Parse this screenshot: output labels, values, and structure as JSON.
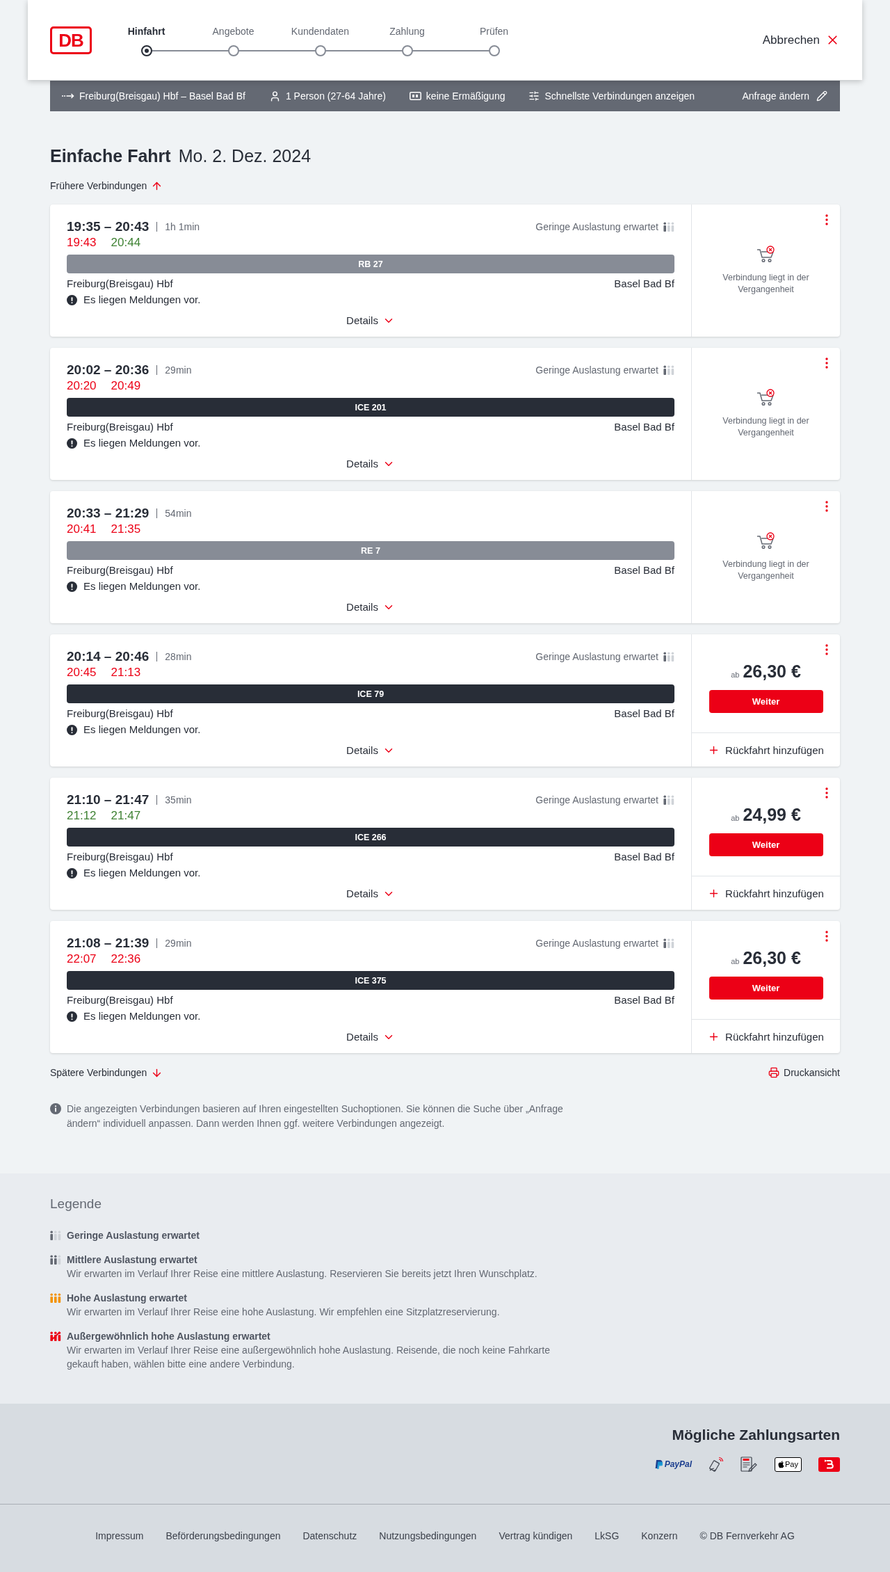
{
  "header": {
    "logo": "DB",
    "steps": [
      {
        "label": "Hinfahrt",
        "selected": true
      },
      {
        "label": "Angebote",
        "selected": false
      },
      {
        "label": "Kundendaten",
        "selected": false
      },
      {
        "label": "Zahlung",
        "selected": false
      },
      {
        "label": "Prüfen",
        "selected": false
      }
    ],
    "cancel": "Abbrechen"
  },
  "search_summary": {
    "route": "Freiburg(Breisgau) Hbf – Basel Bad Bf",
    "travellers": "1 Person (27-64 Jahre)",
    "discount": "keine Ermäßigung",
    "option": "Schnellste Verbindungen anzeigen",
    "edit": "Anfrage ändern"
  },
  "heading": {
    "trip_type": "Einfache Fahrt",
    "date": "Mo. 2. Dez. 2024"
  },
  "earlier_link": "Frühere Verbindungen",
  "connections": [
    {
      "times": "19:35 – 20:43",
      "duration": "1h 1min",
      "departure": {
        "time": "19:43",
        "delayed": true
      },
      "arrival": {
        "time": "20:44",
        "delayed": false
      },
      "occupancy": {
        "kind": "low",
        "text": "Geringe Auslastung erwartet"
      },
      "train": {
        "name": "RB 27",
        "kind": "regional"
      },
      "from": "Freiburg(Breisgau) Hbf",
      "to": "Basel Bad Bf",
      "notice": "Es liegen Meldungen vor.",
      "details": "Details",
      "offer": {
        "kind": "past",
        "text": "Verbindung liegt in der Vergangenheit"
      }
    },
    {
      "times": "20:02 – 20:36",
      "duration": "29min",
      "departure": {
        "time": "20:20",
        "delayed": true
      },
      "arrival": {
        "time": "20:49",
        "delayed": true
      },
      "occupancy": {
        "kind": "low",
        "text": "Geringe Auslastung erwartet"
      },
      "train": {
        "name": "ICE 201",
        "kind": "long_distance"
      },
      "from": "Freiburg(Breisgau) Hbf",
      "to": "Basel Bad Bf",
      "notice": "Es liegen Meldungen vor.",
      "details": "Details",
      "offer": {
        "kind": "past",
        "text": "Verbindung liegt in der Vergangenheit"
      }
    },
    {
      "times": "20:33 – 21:29",
      "duration": "54min",
      "departure": {
        "time": "20:41",
        "delayed": true
      },
      "arrival": {
        "time": "21:35",
        "delayed": true
      },
      "train": {
        "name": "RE 7",
        "kind": "regional"
      },
      "from": "Freiburg(Breisgau) Hbf",
      "to": "Basel Bad Bf",
      "notice": "Es liegen Meldungen vor.",
      "details": "Details",
      "offer": {
        "kind": "past",
        "text": "Verbindung liegt in der Vergangenheit"
      }
    },
    {
      "times": "20:14 – 20:46",
      "duration": "28min",
      "departure": {
        "time": "20:45",
        "delayed": true
      },
      "arrival": {
        "time": "21:13",
        "delayed": true
      },
      "occupancy": {
        "kind": "low",
        "text": "Geringe Auslastung erwartet"
      },
      "train": {
        "name": "ICE 79",
        "kind": "long_distance"
      },
      "from": "Freiburg(Breisgau) Hbf",
      "to": "Basel Bad Bf",
      "notice": "Es liegen Meldungen vor.",
      "details": "Details",
      "offer": {
        "kind": "price",
        "prefix": "ab",
        "price": "26,30 €",
        "button": "Weiter",
        "add_return": "Rückfahrt hinzufügen"
      }
    },
    {
      "times": "21:10 – 21:47",
      "duration": "35min",
      "departure": {
        "time": "21:12",
        "delayed": false
      },
      "arrival": {
        "time": "21:47",
        "delayed": false
      },
      "occupancy": {
        "kind": "low",
        "text": "Geringe Auslastung erwartet"
      },
      "train": {
        "name": "ICE 266",
        "kind": "long_distance"
      },
      "from": "Freiburg(Breisgau) Hbf",
      "to": "Basel Bad Bf",
      "notice": "Es liegen Meldungen vor.",
      "details": "Details",
      "offer": {
        "kind": "price",
        "prefix": "ab",
        "price": "24,99 €",
        "button": "Weiter",
        "add_return": "Rückfahrt hinzufügen"
      }
    },
    {
      "times": "21:08 – 21:39",
      "duration": "29min",
      "departure": {
        "time": "22:07",
        "delayed": true
      },
      "arrival": {
        "time": "22:36",
        "delayed": true
      },
      "occupancy": {
        "kind": "low",
        "text": "Geringe Auslastung erwartet"
      },
      "train": {
        "name": "ICE 375",
        "kind": "long_distance"
      },
      "from": "Freiburg(Breisgau) Hbf",
      "to": "Basel Bad Bf",
      "notice": "Es liegen Meldungen vor.",
      "details": "Details",
      "offer": {
        "kind": "price",
        "prefix": "ab",
        "price": "26,30 €",
        "button": "Weiter",
        "add_return": "Rückfahrt hinzufügen"
      }
    }
  ],
  "later_link": "Spätere Verbindungen",
  "print_link": "Druckansicht",
  "info_note": "Die angezeigten Verbindungen basieren auf Ihren eingestellten Suchoptionen. Sie können die Suche über „Anfrage ändern“ individuell anpassen. Dann werden Ihnen ggf. weitere Verbindungen angezeigt.",
  "legend": {
    "title": "Legende",
    "items": [
      {
        "kind": "low",
        "title": "Geringe Auslastung erwartet"
      },
      {
        "kind": "medium",
        "title": "Mittlere Auslastung erwartet",
        "text": "Wir erwarten im Verlauf Ihrer Reise eine mittlere Auslastung. Reservieren Sie bereits jetzt Ihren Wunschplatz."
      },
      {
        "kind": "high",
        "title": "Hohe Auslastung erwartet",
        "text": "Wir erwarten im Verlauf Ihrer Reise eine hohe Auslastung. Wir empfehlen eine Sitzplatzreservierung."
      },
      {
        "kind": "very_high",
        "title": "Außergewöhnlich hohe Auslastung erwartet",
        "text": "Wir erwarten im Verlauf Ihrer Reise eine außergewöhnlich hohe Auslastung. Reisende, die noch keine Fahrkarte gekauft haben, wählen bitte eine andere Verbindung."
      }
    ]
  },
  "payment": {
    "title": "Mögliche Zahlungsarten",
    "methods": [
      {
        "kind": "paypal",
        "label": "PayPal"
      },
      {
        "kind": "contactless"
      },
      {
        "kind": "sepa"
      },
      {
        "kind": "applepay",
        "label": "Pay"
      },
      {
        "kind": "bonus"
      }
    ]
  },
  "footer": {
    "links": [
      "Impressum",
      "Beförderungsbedingungen",
      "Datenschutz",
      "Nutzungsbedingungen",
      "Vertrag kündigen",
      "LkSG",
      "Konzern"
    ],
    "copyright": "© DB Fernverkehr AG"
  }
}
